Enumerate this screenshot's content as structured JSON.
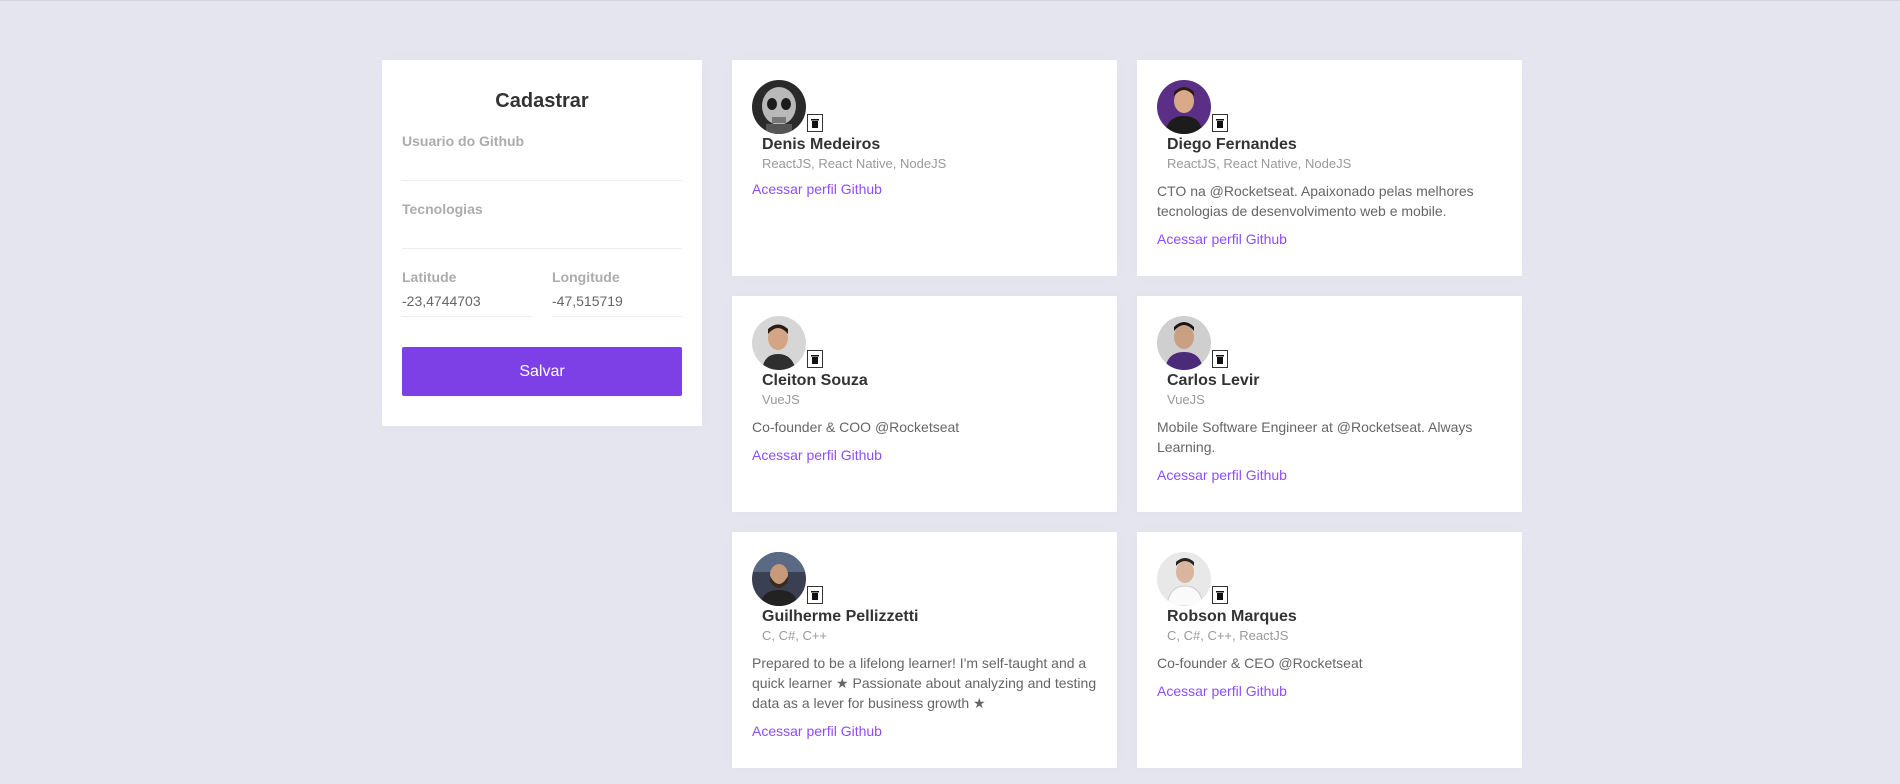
{
  "form": {
    "title": "Cadastrar",
    "github_label": "Usuario do Github",
    "github_value": "",
    "techs_label": "Tecnologias",
    "techs_value": "",
    "latitude_label": "Latitude",
    "latitude_value": "-23,4744703",
    "longitude_label": "Longitude",
    "longitude_value": "-47,515719",
    "submit_label": "Salvar"
  },
  "link_label": "Acessar perfil Github",
  "colors": {
    "background": "#e5e5ef",
    "accent": "#7d40e7",
    "link": "#8e4dff"
  },
  "devs": [
    {
      "name": "Denis Medeiros",
      "techs": "ReactJS, React Native, NodeJS",
      "bio": "",
      "avatar": "robot-avatar",
      "avatar_color": "#3a3a3a"
    },
    {
      "name": "Diego Fernandes",
      "techs": "ReactJS, React Native, NodeJS",
      "bio": "CTO na @Rocketseat. Apaixonado pelas melhores tecnologias de desenvolvimento web e mobile.",
      "avatar": "person-avatar",
      "avatar_color": "#5b2f86"
    },
    {
      "name": "Cleiton Souza",
      "techs": "VueJS",
      "bio": "Co-founder & COO @Rocketseat",
      "avatar": "person-avatar",
      "avatar_color": "#cfcfcf"
    },
    {
      "name": "Carlos Levir",
      "techs": "VueJS",
      "bio": "Mobile Software Engineer at @Rocketseat. Always Learning.",
      "avatar": "person-avatar",
      "avatar_color": "#4b2a7a"
    },
    {
      "name": "Guilherme Pellizzetti",
      "techs": "C, C#, C++",
      "bio": "Prepared to be a lifelong learner! I'm self-taught and a quick learner ★ Passionate about analyzing and testing data as a lever for business growth ★",
      "avatar": "person-avatar",
      "avatar_color": "#3a3f52"
    },
    {
      "name": "Robson Marques",
      "techs": "C, C#, C++, ReactJS",
      "bio": "Co-founder & CEO @Rocketseat",
      "avatar": "person-avatar",
      "avatar_color": "#e8e8e8"
    }
  ]
}
